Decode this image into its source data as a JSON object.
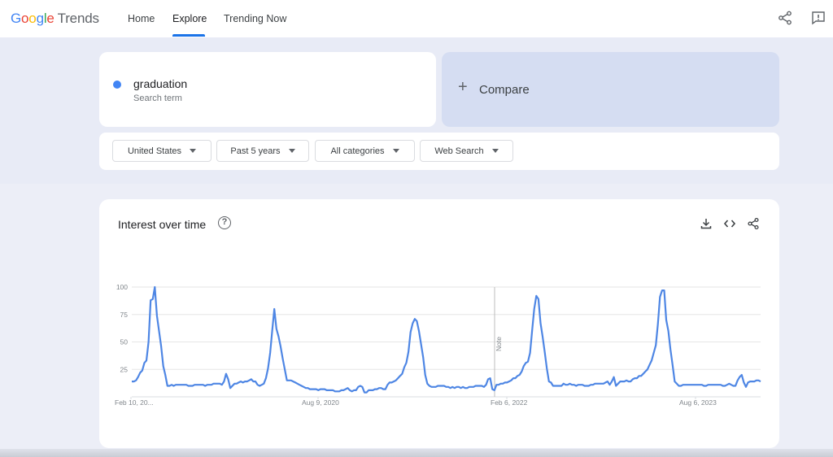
{
  "header": {
    "logo": {
      "google": [
        "G",
        "o",
        "o",
        "g",
        "l",
        "e"
      ],
      "product": "Trends"
    },
    "tabs": [
      {
        "label": "Home",
        "active": false
      },
      {
        "label": "Explore",
        "active": true
      },
      {
        "label": "Trending Now",
        "active": false
      }
    ],
    "icons": [
      "share-icon",
      "feedback-icon"
    ]
  },
  "search": {
    "term": "graduation",
    "term_type": "Search term",
    "term_color": "#4285f4",
    "compare_label": "Compare",
    "filters": [
      "United States",
      "Past 5 years",
      "All categories",
      "Web Search"
    ]
  },
  "chart_card": {
    "title": "Interest over time",
    "icons": [
      "help-icon",
      "download-icon",
      "embed-icon",
      "share-icon"
    ]
  },
  "chart_data": {
    "type": "line",
    "ylim": [
      0,
      100
    ],
    "y_ticks": [
      25,
      50,
      75,
      100
    ],
    "x_tick_labels": [
      "Feb 10, 20...",
      "Aug 9, 2020",
      "Feb 6, 2022",
      "Aug 6, 2023"
    ],
    "annotation": "Note",
    "grid": true,
    "series": [
      {
        "color": "#4e86e4",
        "values": [
          14,
          14,
          15,
          18,
          22,
          24,
          31,
          33,
          50,
          88,
          89,
          100,
          74,
          60,
          46,
          28,
          20,
          10,
          10,
          11,
          10,
          11,
          11,
          11,
          11,
          11,
          11,
          10,
          10,
          10,
          11,
          11,
          11,
          11,
          11,
          10,
          11,
          11,
          11,
          12,
          12,
          12,
          12,
          11,
          14,
          21,
          16,
          8,
          10,
          12,
          12,
          13,
          14,
          13,
          14,
          14,
          15,
          16,
          14,
          14,
          11,
          10,
          11,
          12,
          17,
          26,
          40,
          60,
          80,
          62,
          55,
          46,
          35,
          25,
          15,
          15,
          15,
          14,
          13,
          12,
          11,
          10,
          9,
          8,
          8,
          7,
          7,
          7,
          7,
          6,
          7,
          7,
          7,
          6,
          6,
          6,
          6,
          5,
          5,
          5,
          6,
          6,
          7,
          8,
          6,
          5,
          6,
          6,
          9,
          10,
          9,
          4,
          4,
          6,
          6,
          6,
          7,
          7,
          8,
          8,
          7,
          7,
          11,
          13,
          13,
          14,
          15,
          17,
          19,
          21,
          27,
          31,
          41,
          59,
          67,
          71,
          69,
          60,
          48,
          36,
          20,
          12,
          10,
          9,
          9,
          9,
          10,
          10,
          10,
          10,
          9,
          9,
          8,
          9,
          8,
          9,
          9,
          8,
          9,
          8,
          8,
          9,
          9,
          9,
          10,
          10,
          10,
          10,
          9,
          11,
          16,
          17,
          7,
          6,
          11,
          11,
          12,
          12,
          13,
          13,
          14,
          15,
          17,
          17,
          19,
          20,
          23,
          28,
          31,
          32,
          40,
          60,
          80,
          92,
          89,
          67,
          55,
          41,
          26,
          14,
          13,
          10,
          10,
          10,
          10,
          10,
          12,
          11,
          11,
          12,
          11,
          11,
          10,
          11,
          11,
          11,
          10,
          10,
          10,
          11,
          11,
          12,
          12,
          12,
          12,
          12,
          13,
          14,
          11,
          14,
          18,
          10,
          12,
          14,
          14,
          14,
          15,
          14,
          14,
          16,
          17,
          17,
          19,
          19,
          21,
          23,
          25,
          29,
          33,
          40,
          47,
          66,
          91,
          97,
          97,
          70,
          60,
          43,
          29,
          14,
          12,
          10,
          10,
          11,
          11,
          11,
          11,
          11,
          11,
          11,
          11,
          11,
          11,
          10,
          10,
          11,
          11,
          11,
          11,
          11,
          11,
          11,
          10,
          10,
          11,
          12,
          11,
          10,
          10,
          15,
          18,
          20,
          13,
          9,
          13,
          14,
          14,
          14,
          15,
          15,
          14
        ]
      }
    ]
  }
}
